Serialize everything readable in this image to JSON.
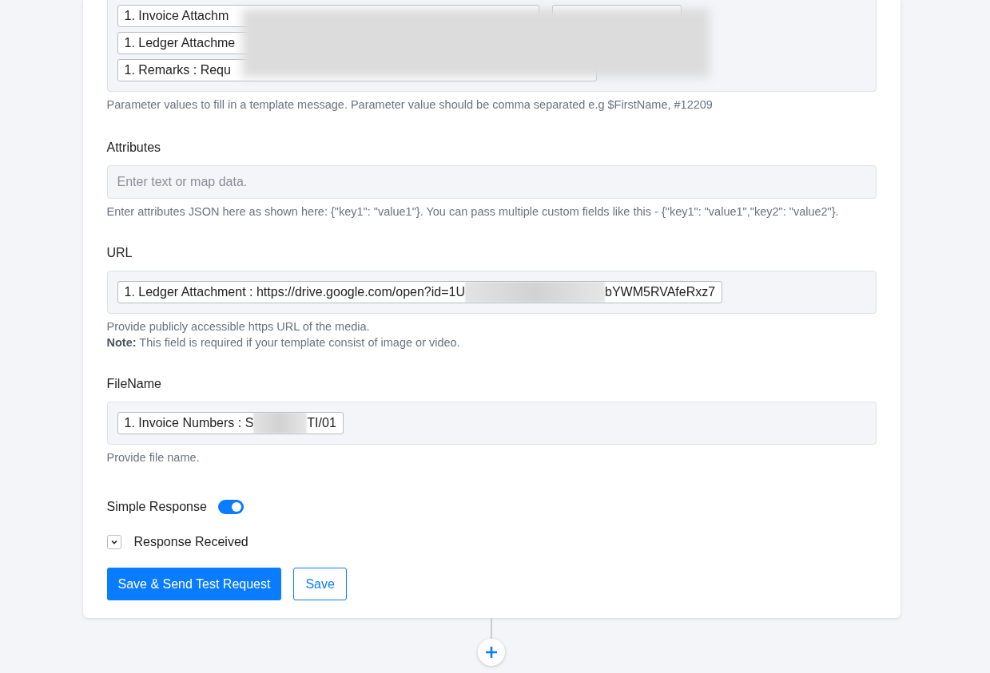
{
  "parameters": {
    "redacted": true,
    "rows": [
      [
        {
          "kind": "text",
          "text": "1. Invoice Attachm"
        },
        {
          "kind": "hidden"
        }
      ],
      [
        {
          "kind": "text",
          "text": "1. Ledger Attachme"
        }
      ],
      [
        {
          "kind": "text",
          "text": "1. Remarks : Requ"
        }
      ]
    ],
    "help": "Parameter values to fill in a template message. Parameter value should be comma separated e.g $FirstName, #12209"
  },
  "attributes": {
    "label": "Attributes",
    "placeholder": "Enter text or map data.",
    "help": "Enter attributes JSON here as shown here: {\"key1\": \"value1\"}. You can pass multiple custom fields like this - {\"key1\": \"value1\",\"key2\": \"value2\"}."
  },
  "url": {
    "label": "URL",
    "chip": {
      "text_start": "1. Ledger Attachment : https://drive.google.com/open?id=1U",
      "text_end": "bYWM5RVAfeRxz7"
    },
    "help": "Provide publicly accessible https URL of the media.",
    "note": "**Note:** This field is required if your template consist of image or video."
  },
  "filename": {
    "label": "FileName",
    "chip": {
      "text_start": "1. Invoice Numbers : S",
      "text_end": "TI/01"
    },
    "help": "Provide file name."
  },
  "simple_response": {
    "label": "Simple Response",
    "on": true
  },
  "response_received": {
    "label": "Response Received",
    "expanded": false
  },
  "buttons": [
    {
      "kind": "primary",
      "label": "Save & Send Test Request"
    },
    {
      "kind": "outline",
      "label": "Save"
    }
  ]
}
